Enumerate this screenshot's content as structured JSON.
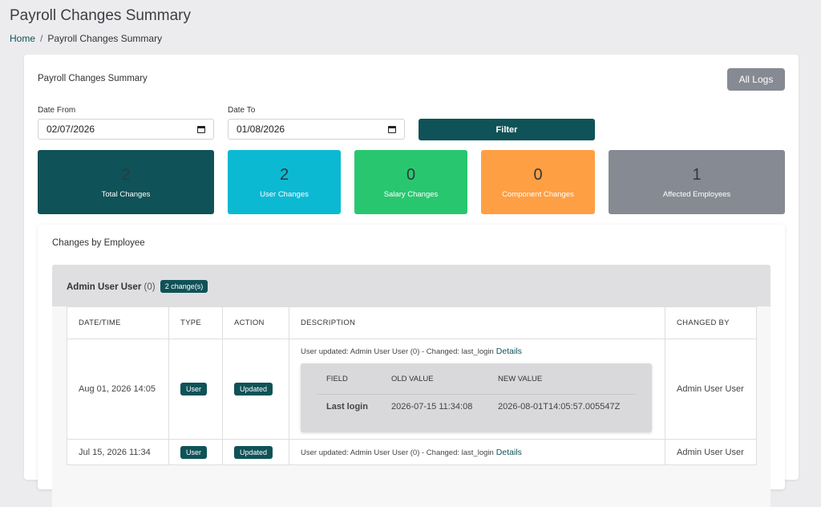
{
  "page": {
    "title": "Payroll Changes Summary",
    "breadcrumb": {
      "home": "Home",
      "separator": "/",
      "current": "Payroll Changes Summary"
    }
  },
  "card": {
    "title": "Payroll Changes Summary",
    "all_logs_label": "All Logs",
    "filters": {
      "date_from_label": "Date From",
      "date_from_value": "02/07/2026",
      "date_to_label": "Date To",
      "date_to_value": "01/08/2026",
      "filter_label": "Filter"
    }
  },
  "stats": [
    {
      "value": "2",
      "label": "Total Changes",
      "color": "#0f5257",
      "value_color": "#2c3a3c"
    },
    {
      "value": "2",
      "label": "User Changes",
      "color": "#0cb9d3",
      "value_color": "#2c3a3c"
    },
    {
      "value": "0",
      "label": "Salary Changes",
      "color": "#28c76f",
      "value_color": "#2c3a3c"
    },
    {
      "value": "0",
      "label": "Component Changes",
      "color": "#ff9f43",
      "value_color": "#2c3a3c"
    },
    {
      "value": "1",
      "label": "Affected Employees",
      "color": "#868a93",
      "value_color": "#2c3a3c"
    }
  ],
  "by_employee": {
    "title": "Changes by Employee",
    "employee": {
      "name": "Admin User User",
      "count": "(0)",
      "badge": "2 change(s)"
    },
    "columns": [
      "DATE/TIME",
      "TYPE",
      "ACTION",
      "DESCRIPTION",
      "CHANGED BY"
    ],
    "rows": [
      {
        "datetime": "Aug 01, 2026 14:05",
        "type": "User",
        "action": "Updated",
        "description": "User updated: Admin User User (0) - Changed: last_login",
        "details_label": "Details",
        "changed_by": "Admin User User",
        "detail": {
          "headers": [
            "FIELD",
            "OLD VALUE",
            "NEW VALUE"
          ],
          "field": "Last login",
          "old_value": "2026-07-15 11:34:08",
          "new_value": "2026-08-01T14:05:57.005547Z"
        }
      },
      {
        "datetime": "Jul 15, 2026 11:34",
        "type": "User",
        "action": "Updated",
        "description": "User updated: Admin User User (0) - Changed: last_login",
        "details_label": "Details",
        "changed_by": "Admin User User"
      }
    ]
  }
}
